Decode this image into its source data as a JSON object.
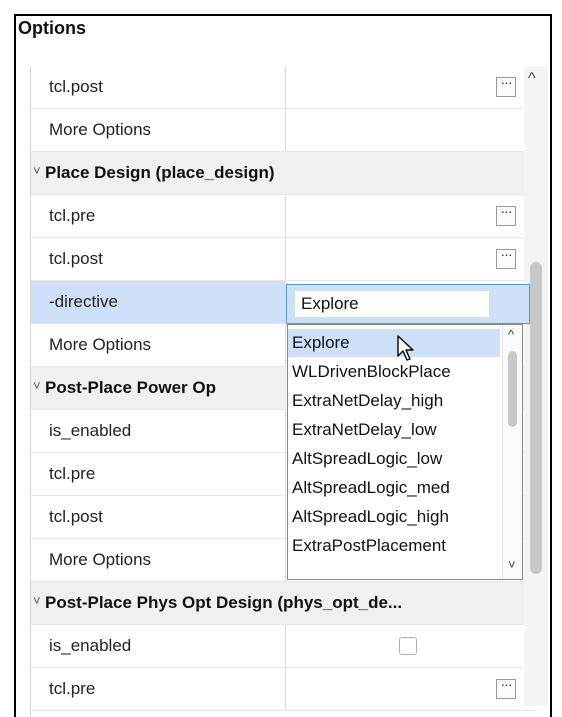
{
  "panel": {
    "title": "Options"
  },
  "rows": [
    {
      "name": "tcl.post",
      "ellipsis": "···"
    },
    {
      "name": "More Options"
    },
    {
      "name": "Place Design (place_design)",
      "caret": "˅"
    },
    {
      "name": "tcl.pre",
      "ellipsis": "···"
    },
    {
      "name": "tcl.post",
      "ellipsis": "···"
    },
    {
      "name": "-directive"
    },
    {
      "name": "More Options"
    },
    {
      "name": "Post-Place Power Op",
      "caret": "˅"
    },
    {
      "name": "is_enabled"
    },
    {
      "name": "tcl.pre"
    },
    {
      "name": "tcl.post"
    },
    {
      "name": "More Options"
    },
    {
      "name": "Post-Place Phys Opt Design (phys_opt_de...",
      "caret": "˅"
    },
    {
      "name": "is_enabled",
      "checked": false
    },
    {
      "name": "tcl.pre",
      "ellipsis": "···"
    }
  ],
  "directive": {
    "value": "Explore",
    "options": [
      "Explore",
      "WLDrivenBlockPlace",
      "ExtraNetDelay_high",
      "ExtraNetDelay_low",
      "AltSpreadLogic_low",
      "AltSpreadLogic_med",
      "AltSpreadLogic_high",
      "ExtraPostPlacement"
    ],
    "highlighted": "Explore"
  },
  "scrollbar": {
    "up_glyph": "^"
  },
  "dropdown_scroll": {
    "up_glyph": "^",
    "down_glyph": "˅"
  },
  "colors": {
    "selection": "#cde0f7",
    "focus_border": "#5b9bd5",
    "group_bg": "#f0f0f0"
  }
}
